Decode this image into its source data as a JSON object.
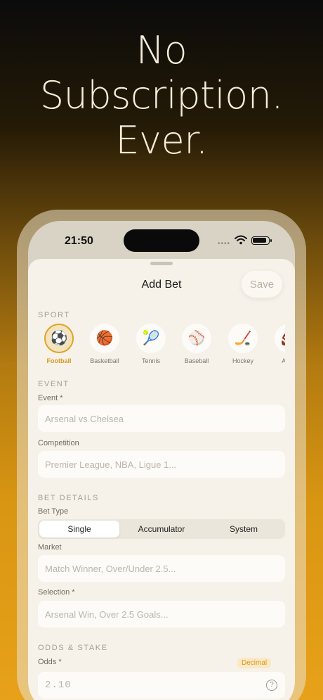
{
  "headline": {
    "line1": "No",
    "line2": "Subscription.",
    "line3": "Ever."
  },
  "status_bar": {
    "time": "21:50",
    "signal_icon": "cellular-dots-icon",
    "wifi_icon": "wifi-icon",
    "battery_icon": "battery-icon"
  },
  "sheet": {
    "title": "Add Bet",
    "save_label": "Save"
  },
  "sport_section": {
    "title": "SPORT",
    "items": [
      {
        "label": "Football",
        "icon": "⚽",
        "active": true
      },
      {
        "label": "Basketball",
        "icon": "🏀",
        "active": false
      },
      {
        "label": "Tennis",
        "icon": "🎾",
        "active": false
      },
      {
        "label": "Baseball",
        "icon": "⚾",
        "active": false
      },
      {
        "label": "Hockey",
        "icon": "🏒",
        "active": false
      },
      {
        "label": "Amer",
        "icon": "🏈",
        "active": false
      }
    ]
  },
  "event_section": {
    "title": "EVENT",
    "event_label": "Event *",
    "event_placeholder": "Arsenal vs Chelsea",
    "competition_label": "Competition",
    "competition_placeholder": "Premier League, NBA, Ligue 1..."
  },
  "bet_details_section": {
    "title": "BET DETAILS",
    "bet_type_label": "Bet Type",
    "bet_types": [
      "Single",
      "Accumulator",
      "System"
    ],
    "selected_bet_type": "Single",
    "market_label": "Market",
    "market_placeholder": "Match Winner, Over/Under 2.5...",
    "selection_label": "Selection *",
    "selection_placeholder": "Arsenal Win, Over 2.5 Goals..."
  },
  "odds_section": {
    "title": "ODDS & STAKE",
    "odds_label": "Odds *",
    "odds_format": "Decimal",
    "odds_placeholder": "2.10",
    "help_glyph": "?"
  },
  "colors": {
    "accent": "#E0A424",
    "sheet_background": "#F6F2EA",
    "field_background": "#FCFBF7"
  }
}
